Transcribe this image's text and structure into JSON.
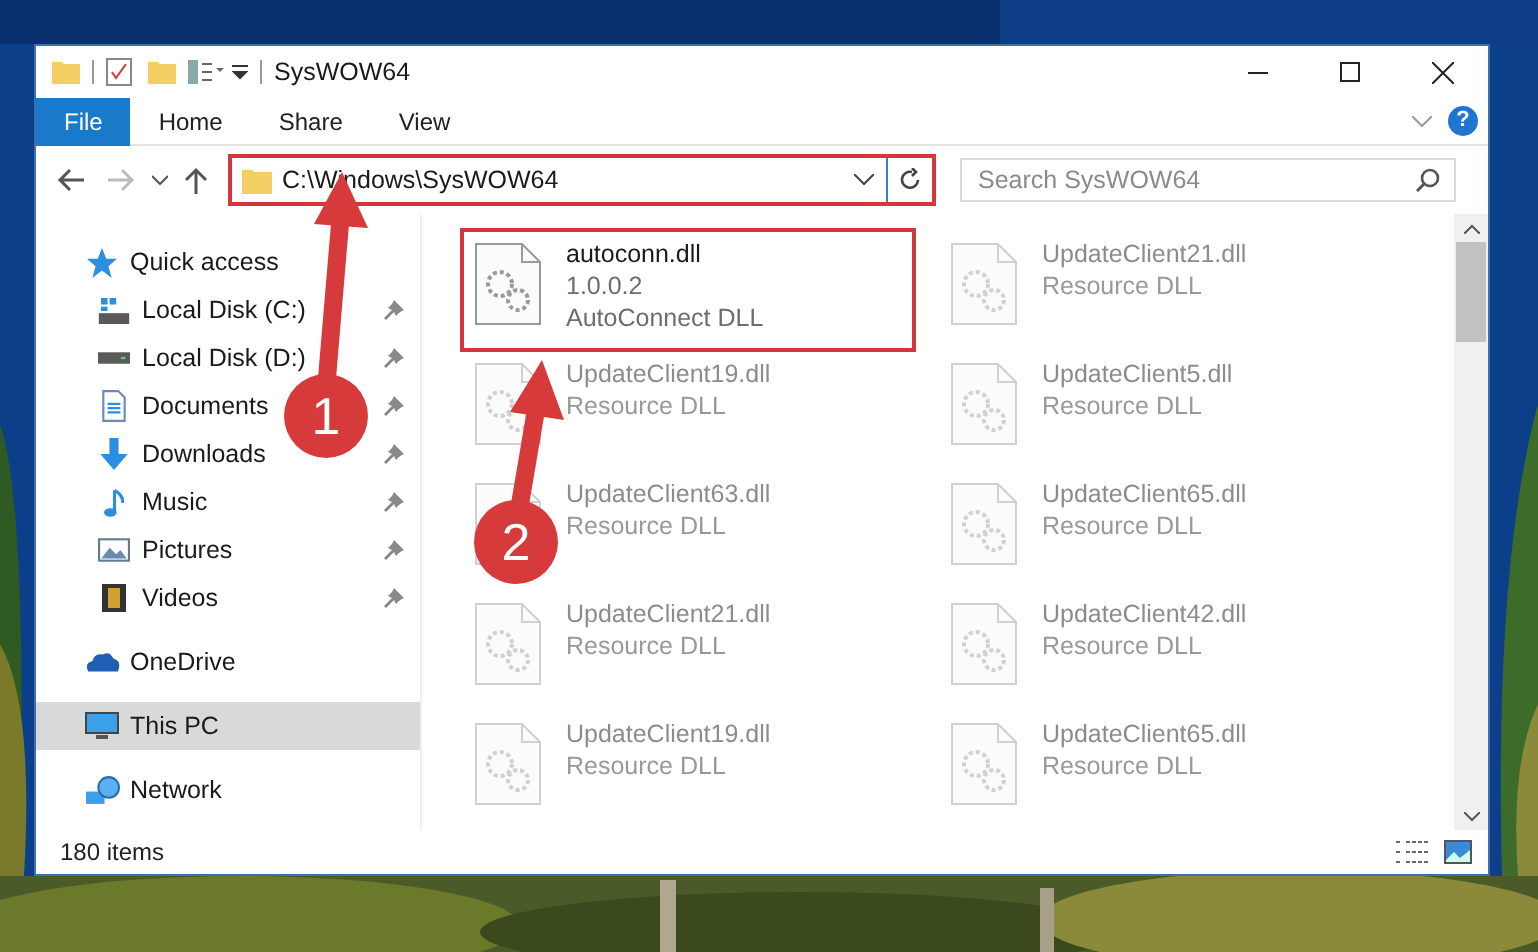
{
  "window": {
    "title": "SysWOW64"
  },
  "ribbon_tabs": [
    {
      "label": "File",
      "selected": true
    },
    {
      "label": "Home",
      "selected": false
    },
    {
      "label": "Share",
      "selected": false
    },
    {
      "label": "View",
      "selected": false
    }
  ],
  "help": "?",
  "address": {
    "value": "C:\\Windows\\SysWOW64",
    "highlighted": true
  },
  "search": {
    "placeholder": "Search SysWOW64"
  },
  "sidebar": {
    "items": [
      {
        "label": "Quick access",
        "pinned": false,
        "selected": false,
        "children": [
          {
            "label": "Local Disk (C:)",
            "pinned": true,
            "selected": false
          },
          {
            "label": "Local Disk (D:)",
            "pinned": true,
            "selected": false
          },
          {
            "label": "Documents",
            "pinned": true,
            "selected": false
          },
          {
            "label": "Downloads",
            "pinned": true,
            "selected": false
          },
          {
            "label": "Music",
            "pinned": true,
            "selected": false
          },
          {
            "label": "Pictures",
            "pinned": true,
            "selected": false
          },
          {
            "label": "Videos",
            "pinned": true,
            "selected": false
          }
        ]
      },
      {
        "label": "OneDrive",
        "pinned": false,
        "selected": false
      },
      {
        "label": "This PC",
        "pinned": false,
        "selected": true
      },
      {
        "label": "Network",
        "pinned": false,
        "selected": false
      }
    ]
  },
  "files": [
    {
      "name": "autoconn.dll",
      "lines": [
        "1.0.0.2",
        "AutoConnect DLL"
      ],
      "highlighted": true,
      "blurred": false
    },
    {
      "name": "UpdateClient21.dll",
      "lines": [
        "Resource DLL"
      ],
      "highlighted": false,
      "blurred": true
    },
    {
      "name": "UpdateClient19.dll",
      "lines": [
        "Resource DLL"
      ],
      "highlighted": false,
      "blurred": true
    },
    {
      "name": "UpdateClient5.dll",
      "lines": [
        "Resource DLL"
      ],
      "highlighted": false,
      "blurred": true
    },
    {
      "name": "UpdateClient63.dll",
      "lines": [
        "Resource DLL"
      ],
      "highlighted": false,
      "blurred": true
    },
    {
      "name": "UpdateClient65.dll",
      "lines": [
        "Resource DLL"
      ],
      "highlighted": false,
      "blurred": true
    },
    {
      "name": "UpdateClient21.dll",
      "lines": [
        "Resource DLL"
      ],
      "highlighted": false,
      "blurred": true
    },
    {
      "name": "UpdateClient42.dll",
      "lines": [
        "Resource DLL"
      ],
      "highlighted": false,
      "blurred": true
    },
    {
      "name": "UpdateClient19.dll",
      "lines": [
        "Resource DLL"
      ],
      "highlighted": false,
      "blurred": true
    },
    {
      "name": "UpdateClient65.dll",
      "lines": [
        "Resource DLL"
      ],
      "highlighted": false,
      "blurred": true
    }
  ],
  "status_bar": {
    "item_count": "180 items"
  },
  "annotations": [
    {
      "label": "1"
    },
    {
      "label": "2"
    }
  ]
}
